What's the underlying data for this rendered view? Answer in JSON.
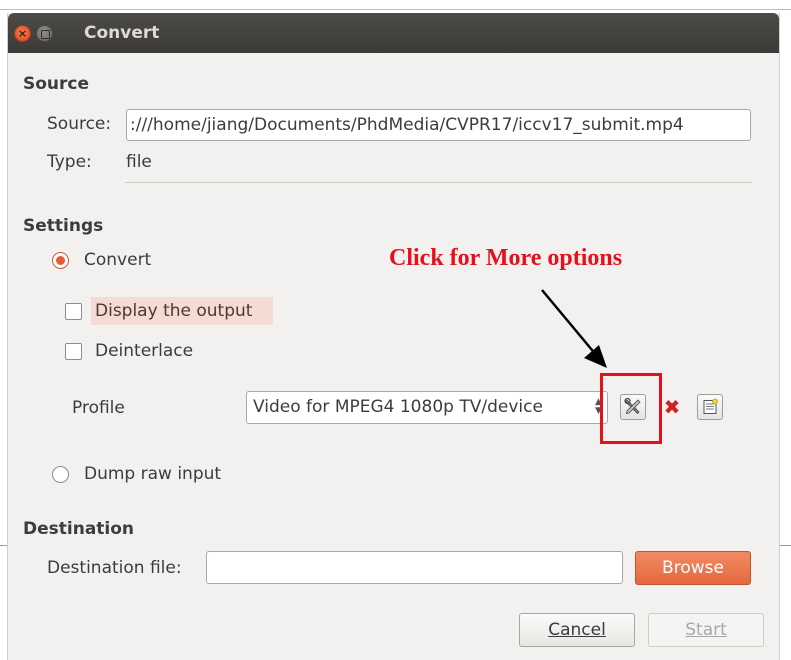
{
  "window": {
    "title": "Convert"
  },
  "source": {
    "heading": "Source",
    "source_label": "Source:",
    "source_value": ":///home/jiang/Documents/PhdMedia/CVPR17/iccv17_submit.mp4",
    "type_label": "Type:",
    "type_value": "file"
  },
  "settings": {
    "heading": "Settings",
    "convert_label": "Convert",
    "display_output_label": "Display the output",
    "deinterlace_label": "Deinterlace",
    "profile_label": "Profile",
    "profile_value": "Video for MPEG4 1080p TV/device",
    "dump_raw_label": "Dump raw input"
  },
  "destination": {
    "heading": "Destination",
    "file_label": "Destination file:",
    "file_value": "",
    "browse_label": "Browse"
  },
  "buttons": {
    "cancel_label": "Cancel",
    "start_label": "Start"
  },
  "annotation": {
    "text": "Click for More options",
    "color": "#e5101b"
  },
  "colors": {
    "accent": "#e4693f",
    "titlebar": "#3f3e3a"
  },
  "icons": {
    "edit_profile": "wrench-screwdriver-icon",
    "delete_profile": "red-x-icon",
    "new_profile": "new-document-icon"
  }
}
